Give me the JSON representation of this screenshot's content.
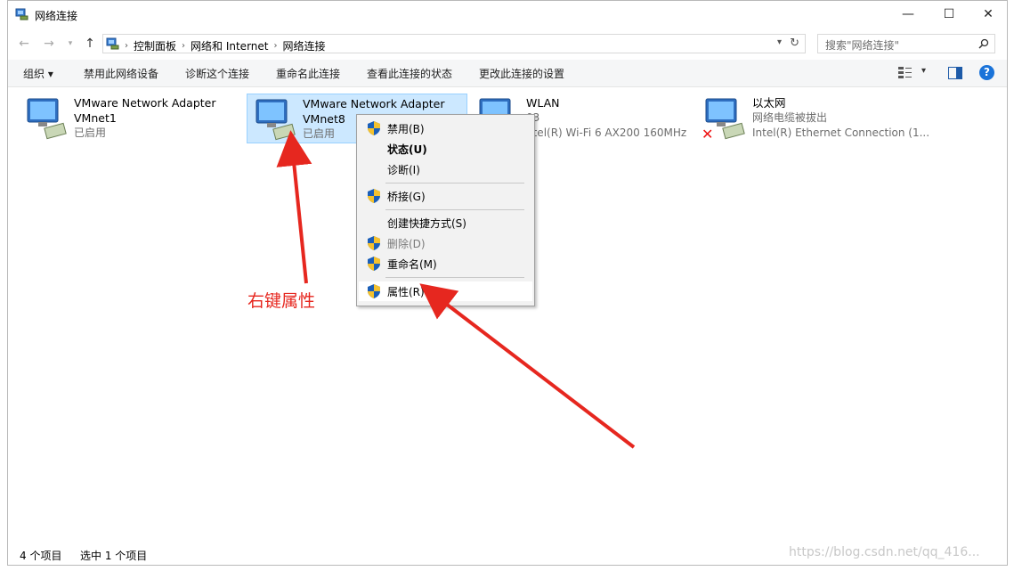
{
  "window": {
    "title": "网络连接"
  },
  "window_controls": {
    "minimize": "—",
    "maximize": "☐",
    "close": "✕"
  },
  "address": {
    "crumbs": [
      "控制面板",
      "网络和 Internet",
      "网络连接"
    ],
    "search_placeholder": "搜索\"网络连接\""
  },
  "toolbar": {
    "items": [
      "组织 ▾",
      "禁用此网络设备",
      "诊断这个连接",
      "重命名此连接",
      "查看此连接的状态",
      "更改此连接的设置"
    ]
  },
  "connections": [
    {
      "name": "VMware Network Adapter",
      "line2": "VMnet1",
      "line3": "已启用",
      "icon": "network-adapter-icon",
      "selected": false,
      "disconnected": false
    },
    {
      "name": "VMware Network Adapter",
      "line2": "VMnet8",
      "line3": "已启用",
      "icon": "network-adapter-icon",
      "selected": true,
      "disconnected": false
    },
    {
      "name": "WLAN",
      "line2": "03",
      "line3": "ntel(R) Wi-Fi 6 AX200 160MHz",
      "icon": "network-adapter-icon",
      "selected": false,
      "disconnected": false
    },
    {
      "name": "以太网",
      "line2": "网络电缆被拔出",
      "line3": "Intel(R) Ethernet Connection (1...",
      "icon": "network-adapter-icon",
      "selected": false,
      "disconnected": true
    }
  ],
  "context_menu": {
    "items": [
      {
        "label": "禁用(B)",
        "shield": true,
        "bold": false,
        "disabled": false
      },
      {
        "label": "状态(U)",
        "shield": false,
        "bold": true,
        "disabled": false
      },
      {
        "label": "诊断(I)",
        "shield": false,
        "bold": false,
        "disabled": false
      },
      {
        "label": "桥接(G)",
        "shield": true,
        "bold": false,
        "disabled": false
      },
      {
        "label": "创建快捷方式(S)",
        "shield": false,
        "bold": false,
        "disabled": false
      },
      {
        "label": "删除(D)",
        "shield": true,
        "bold": false,
        "disabled": true
      },
      {
        "label": "重命名(M)",
        "shield": true,
        "bold": false,
        "disabled": false
      },
      {
        "label": "属性(R)",
        "shield": true,
        "bold": false,
        "disabled": false,
        "highlighted": true
      }
    ]
  },
  "status_bar": {
    "count": "4 个项目",
    "selected": "选中 1 个项目"
  },
  "annotation": {
    "text": "右键属性",
    "color": "#e6271f"
  },
  "watermark": "https://blog.csdn.net/qq_416...",
  "colors": {
    "selection": "#cce8ff",
    "help": "#1a73d9"
  }
}
